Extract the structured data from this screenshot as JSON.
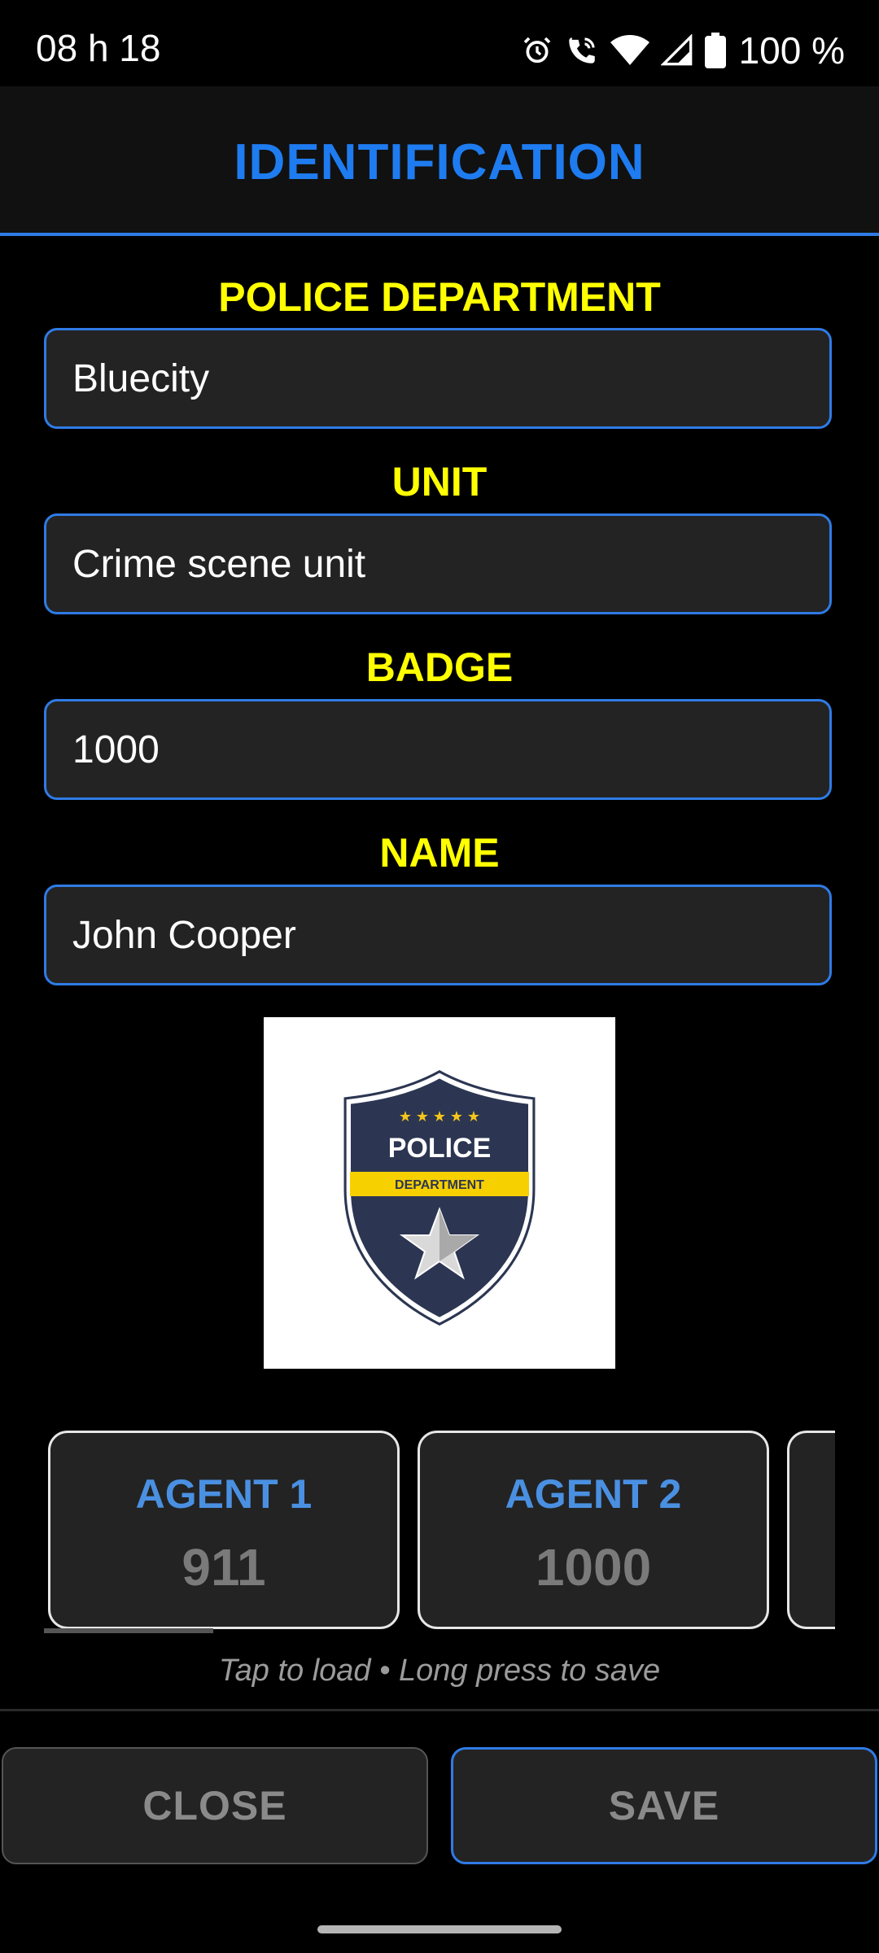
{
  "status_bar": {
    "time": "08 h 18",
    "battery": "100 %"
  },
  "header": {
    "title": "IDENTIFICATION"
  },
  "form": {
    "department": {
      "label": "POLICE DEPARTMENT",
      "value": "Bluecity"
    },
    "unit": {
      "label": "UNIT",
      "value": "Crime scene unit"
    },
    "badge": {
      "label": "BADGE",
      "value": "1000"
    },
    "name": {
      "label": "NAME",
      "value": "John Cooper"
    }
  },
  "logo": {
    "top_text": "POLICE",
    "band_text": "DEPARTMENT"
  },
  "agents": [
    {
      "name": "AGENT 1",
      "badge": "911"
    },
    {
      "name": "AGENT 2",
      "badge": "1000"
    }
  ],
  "hint": "Tap to load • Long press to save",
  "buttons": {
    "close": "CLOSE",
    "save": "SAVE"
  },
  "colors": {
    "accent_blue": "#2f7be6",
    "label_yellow": "#ffff00",
    "title_blue": "#1e7cf0"
  }
}
